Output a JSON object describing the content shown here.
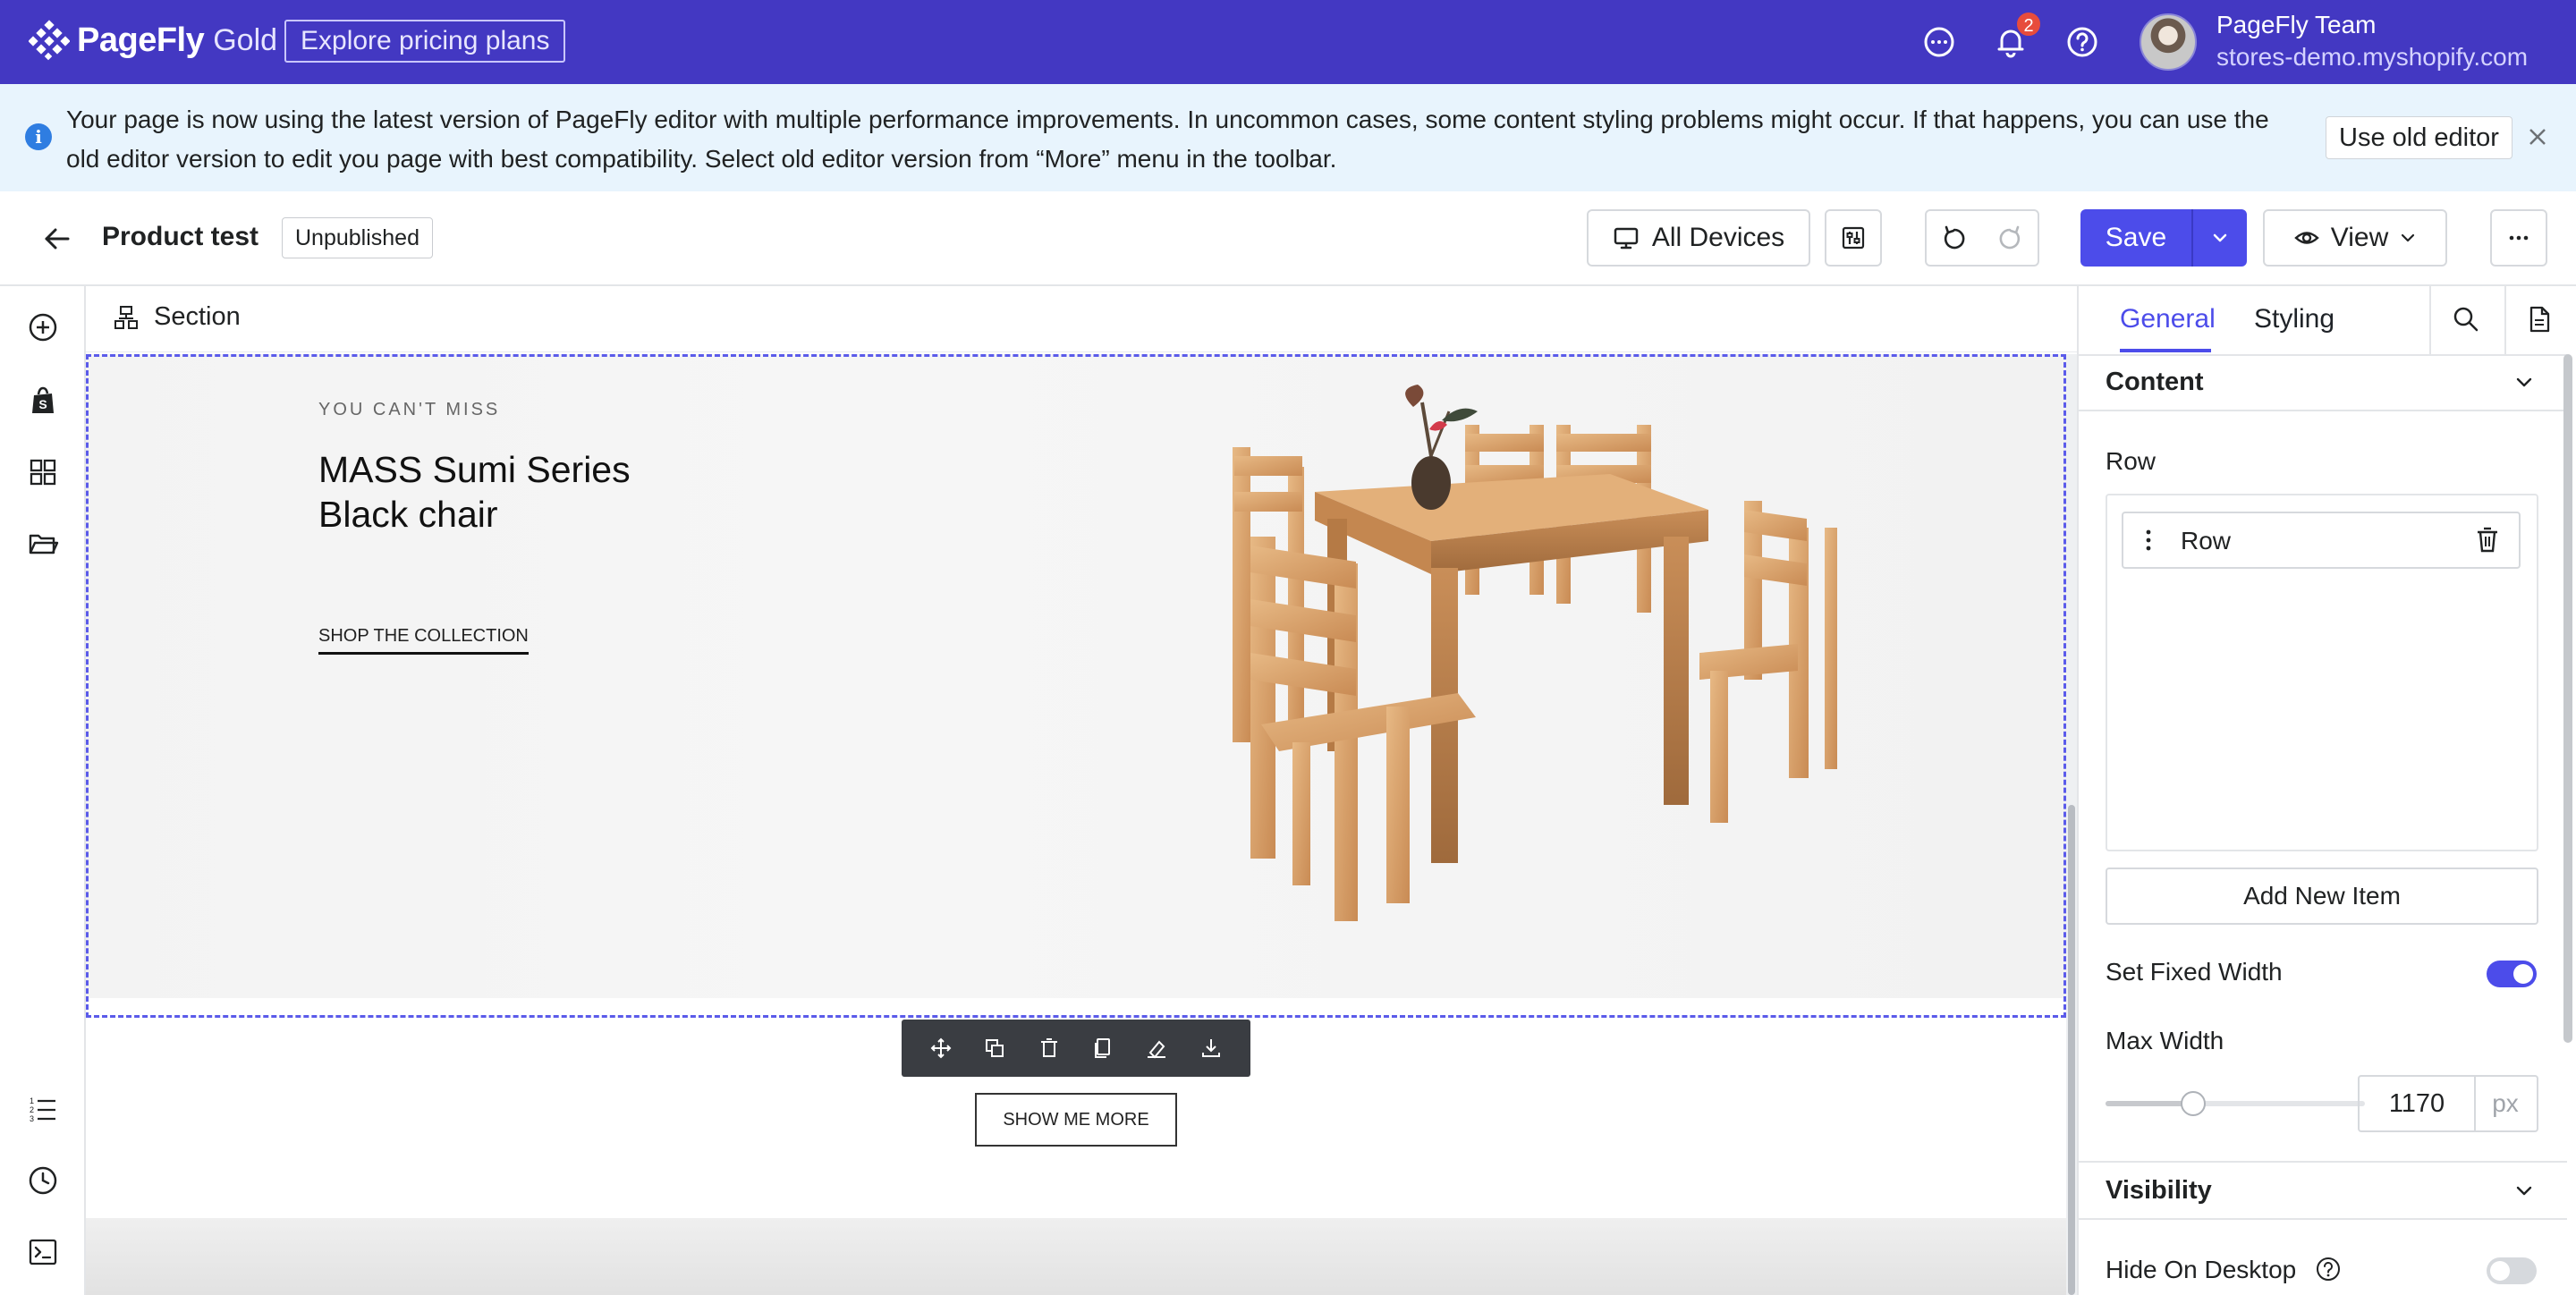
{
  "header": {
    "brand_name": "PageFly",
    "brand_tier": "Gold",
    "pricing_button": "Explore pricing plans",
    "notification_count": "2",
    "user_name": "PageFly Team",
    "user_store": "stores-demo.myshopify.com",
    "icons": [
      "chat-icon",
      "bell-icon",
      "help-icon"
    ]
  },
  "banner": {
    "text": "Your page is now using the latest version of PageFly editor with multiple performance improvements. In uncommon cases, some content styling problems might occur. If that happens, you can use the old editor version to edit you page with best compatibility. Select old editor version from “More” menu in the toolbar.",
    "button": "Use old editor"
  },
  "toolbar": {
    "page_title": "Product test",
    "status": "Unpublished",
    "devices": "All Devices",
    "save": "Save",
    "view": "View"
  },
  "canvas": {
    "breadcrumb": "Section",
    "hero": {
      "kicker": "YOU CAN'T MISS",
      "title_line1": "MASS Sumi Series",
      "title_line2": "Black chair",
      "link": "SHOP THE COLLECTION"
    },
    "show_more": "SHOW ME MORE"
  },
  "panel": {
    "tabs": [
      "General",
      "Styling"
    ],
    "active_tab": "General",
    "content_heading": "Content",
    "row_label": "Row",
    "row_item": "Row",
    "add_item": "Add New Item",
    "fixed_width_label": "Set Fixed Width",
    "fixed_width_on": true,
    "max_width_label": "Max Width",
    "max_width_value": "1170",
    "max_width_unit": "px",
    "visibility_heading": "Visibility",
    "hide_desktop_label": "Hide On Desktop",
    "hide_desktop_on": false
  },
  "colors": {
    "topbar": "#4338c2",
    "accent": "#4c4cea",
    "banner_bg": "#e8f4fd"
  }
}
